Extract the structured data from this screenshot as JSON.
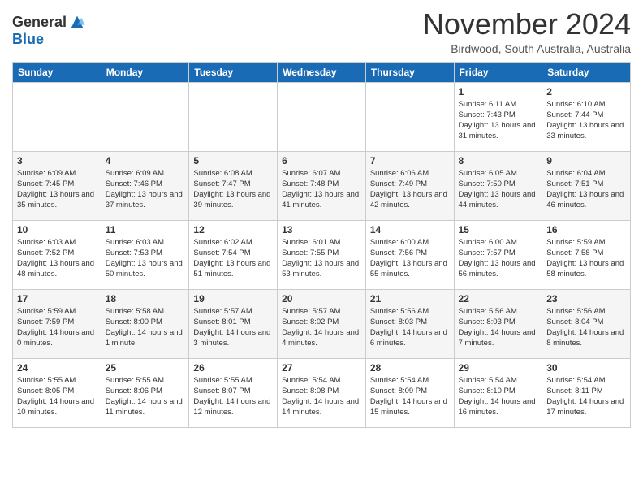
{
  "header": {
    "logo_general": "General",
    "logo_blue": "Blue",
    "month_title": "November 2024",
    "location": "Birdwood, South Australia, Australia"
  },
  "weekdays": [
    "Sunday",
    "Monday",
    "Tuesday",
    "Wednesday",
    "Thursday",
    "Friday",
    "Saturday"
  ],
  "weeks": [
    [
      {
        "day": "",
        "info": ""
      },
      {
        "day": "",
        "info": ""
      },
      {
        "day": "",
        "info": ""
      },
      {
        "day": "",
        "info": ""
      },
      {
        "day": "",
        "info": ""
      },
      {
        "day": "1",
        "info": "Sunrise: 6:11 AM\nSunset: 7:43 PM\nDaylight: 13 hours and 31 minutes."
      },
      {
        "day": "2",
        "info": "Sunrise: 6:10 AM\nSunset: 7:44 PM\nDaylight: 13 hours and 33 minutes."
      }
    ],
    [
      {
        "day": "3",
        "info": "Sunrise: 6:09 AM\nSunset: 7:45 PM\nDaylight: 13 hours and 35 minutes."
      },
      {
        "day": "4",
        "info": "Sunrise: 6:09 AM\nSunset: 7:46 PM\nDaylight: 13 hours and 37 minutes."
      },
      {
        "day": "5",
        "info": "Sunrise: 6:08 AM\nSunset: 7:47 PM\nDaylight: 13 hours and 39 minutes."
      },
      {
        "day": "6",
        "info": "Sunrise: 6:07 AM\nSunset: 7:48 PM\nDaylight: 13 hours and 41 minutes."
      },
      {
        "day": "7",
        "info": "Sunrise: 6:06 AM\nSunset: 7:49 PM\nDaylight: 13 hours and 42 minutes."
      },
      {
        "day": "8",
        "info": "Sunrise: 6:05 AM\nSunset: 7:50 PM\nDaylight: 13 hours and 44 minutes."
      },
      {
        "day": "9",
        "info": "Sunrise: 6:04 AM\nSunset: 7:51 PM\nDaylight: 13 hours and 46 minutes."
      }
    ],
    [
      {
        "day": "10",
        "info": "Sunrise: 6:03 AM\nSunset: 7:52 PM\nDaylight: 13 hours and 48 minutes."
      },
      {
        "day": "11",
        "info": "Sunrise: 6:03 AM\nSunset: 7:53 PM\nDaylight: 13 hours and 50 minutes."
      },
      {
        "day": "12",
        "info": "Sunrise: 6:02 AM\nSunset: 7:54 PM\nDaylight: 13 hours and 51 minutes."
      },
      {
        "day": "13",
        "info": "Sunrise: 6:01 AM\nSunset: 7:55 PM\nDaylight: 13 hours and 53 minutes."
      },
      {
        "day": "14",
        "info": "Sunrise: 6:00 AM\nSunset: 7:56 PM\nDaylight: 13 hours and 55 minutes."
      },
      {
        "day": "15",
        "info": "Sunrise: 6:00 AM\nSunset: 7:57 PM\nDaylight: 13 hours and 56 minutes."
      },
      {
        "day": "16",
        "info": "Sunrise: 5:59 AM\nSunset: 7:58 PM\nDaylight: 13 hours and 58 minutes."
      }
    ],
    [
      {
        "day": "17",
        "info": "Sunrise: 5:59 AM\nSunset: 7:59 PM\nDaylight: 14 hours and 0 minutes."
      },
      {
        "day": "18",
        "info": "Sunrise: 5:58 AM\nSunset: 8:00 PM\nDaylight: 14 hours and 1 minute."
      },
      {
        "day": "19",
        "info": "Sunrise: 5:57 AM\nSunset: 8:01 PM\nDaylight: 14 hours and 3 minutes."
      },
      {
        "day": "20",
        "info": "Sunrise: 5:57 AM\nSunset: 8:02 PM\nDaylight: 14 hours and 4 minutes."
      },
      {
        "day": "21",
        "info": "Sunrise: 5:56 AM\nSunset: 8:03 PM\nDaylight: 14 hours and 6 minutes."
      },
      {
        "day": "22",
        "info": "Sunrise: 5:56 AM\nSunset: 8:03 PM\nDaylight: 14 hours and 7 minutes."
      },
      {
        "day": "23",
        "info": "Sunrise: 5:56 AM\nSunset: 8:04 PM\nDaylight: 14 hours and 8 minutes."
      }
    ],
    [
      {
        "day": "24",
        "info": "Sunrise: 5:55 AM\nSunset: 8:05 PM\nDaylight: 14 hours and 10 minutes."
      },
      {
        "day": "25",
        "info": "Sunrise: 5:55 AM\nSunset: 8:06 PM\nDaylight: 14 hours and 11 minutes."
      },
      {
        "day": "26",
        "info": "Sunrise: 5:55 AM\nSunset: 8:07 PM\nDaylight: 14 hours and 12 minutes."
      },
      {
        "day": "27",
        "info": "Sunrise: 5:54 AM\nSunset: 8:08 PM\nDaylight: 14 hours and 14 minutes."
      },
      {
        "day": "28",
        "info": "Sunrise: 5:54 AM\nSunset: 8:09 PM\nDaylight: 14 hours and 15 minutes."
      },
      {
        "day": "29",
        "info": "Sunrise: 5:54 AM\nSunset: 8:10 PM\nDaylight: 14 hours and 16 minutes."
      },
      {
        "day": "30",
        "info": "Sunrise: 5:54 AM\nSunset: 8:11 PM\nDaylight: 14 hours and 17 minutes."
      }
    ]
  ]
}
